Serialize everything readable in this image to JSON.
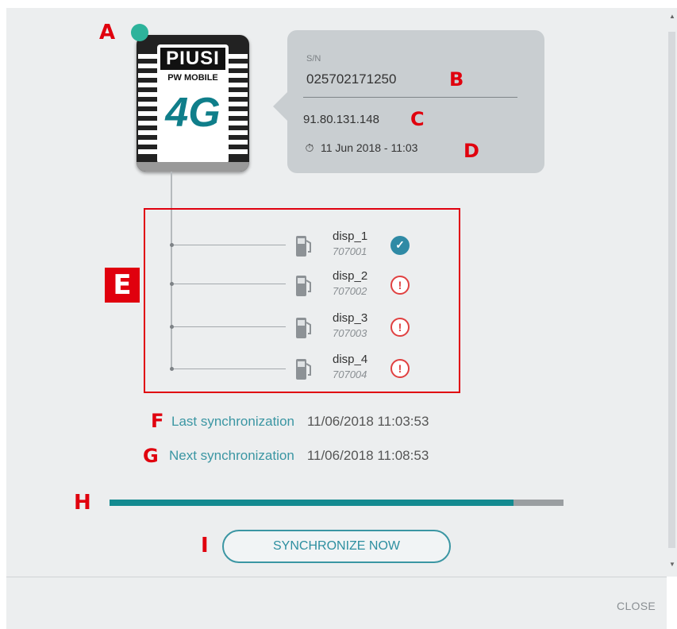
{
  "device": {
    "brand": "PIUSI",
    "model": "PW MOBILE",
    "network": "4G",
    "sn_label": "S/N",
    "serial": "025702171250",
    "ip": "91.80.131.148",
    "timestamp": "11 Jun 2018 - 11:03",
    "status_color": "#2db39b"
  },
  "annotations": {
    "a": "A",
    "b": "B",
    "c": "C",
    "d": "D",
    "e": "E",
    "f": "F",
    "g": "G",
    "h": "H",
    "i": "I"
  },
  "dispensers": [
    {
      "name": "disp_1",
      "code": "707001",
      "state": "ok",
      "icon": "check-circle-icon"
    },
    {
      "name": "disp_2",
      "code": "707002",
      "state": "error",
      "icon": "alert-circle-icon"
    },
    {
      "name": "disp_3",
      "code": "707003",
      "state": "error",
      "icon": "alert-circle-icon"
    },
    {
      "name": "disp_4",
      "code": "707004",
      "state": "error",
      "icon": "alert-circle-icon"
    }
  ],
  "sync": {
    "last_label": "Last synchronization",
    "last_value": "11/06/2018 11:03:53",
    "next_label": "Next synchronization",
    "next_value": "11/06/2018 11:08:53",
    "progress_fraction": 0.89,
    "button_label": "SYNCHRONIZE NOW"
  },
  "footer": {
    "close_label": "CLOSE"
  },
  "colors": {
    "accent": "#138a90",
    "link": "#3b96a3",
    "error": "#e04040",
    "annotation": "#e0000e"
  }
}
